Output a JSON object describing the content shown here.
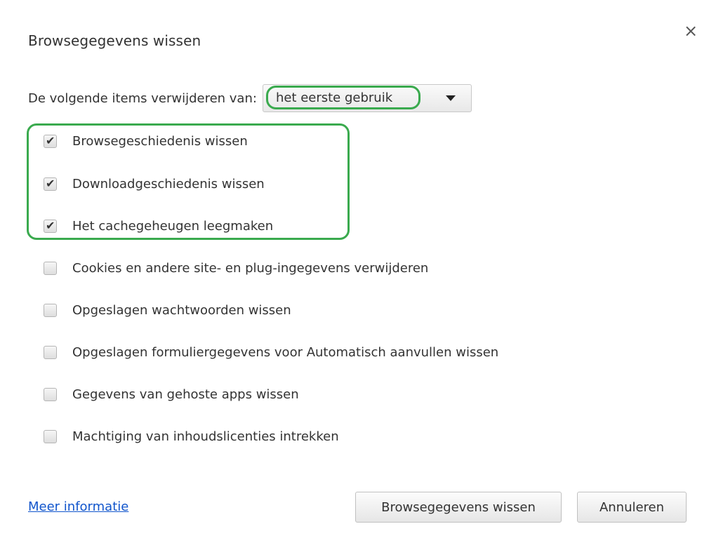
{
  "dialog": {
    "title": "Browsegegevens wissen",
    "close_icon": "close-icon",
    "close_glyph": "×"
  },
  "time_range": {
    "label": "De volgende items verwijderen van:",
    "selected": "het eerste gebruik"
  },
  "options": [
    {
      "label": "Browsegeschiedenis wissen",
      "checked": true
    },
    {
      "label": "Downloadgeschiedenis wissen",
      "checked": true
    },
    {
      "label": "Het cachegeheugen leegmaken",
      "checked": true
    },
    {
      "label": "Cookies en andere site- en plug-ingegevens verwijderen",
      "checked": false
    },
    {
      "label": "Opgeslagen wachtwoorden wissen",
      "checked": false
    },
    {
      "label": "Opgeslagen formuliergegevens voor Automatisch aanvullen wissen",
      "checked": false
    },
    {
      "label": "Gegevens van gehoste apps wissen",
      "checked": false
    },
    {
      "label": "Machtiging van inhoudslicenties intrekken",
      "checked": false
    }
  ],
  "footer": {
    "more_info": "Meer informatie",
    "clear_button": "Browsegegevens wissen",
    "cancel_button": "Annuleren"
  },
  "colors": {
    "highlight": "#3aaa4e",
    "link": "#1155cc"
  }
}
